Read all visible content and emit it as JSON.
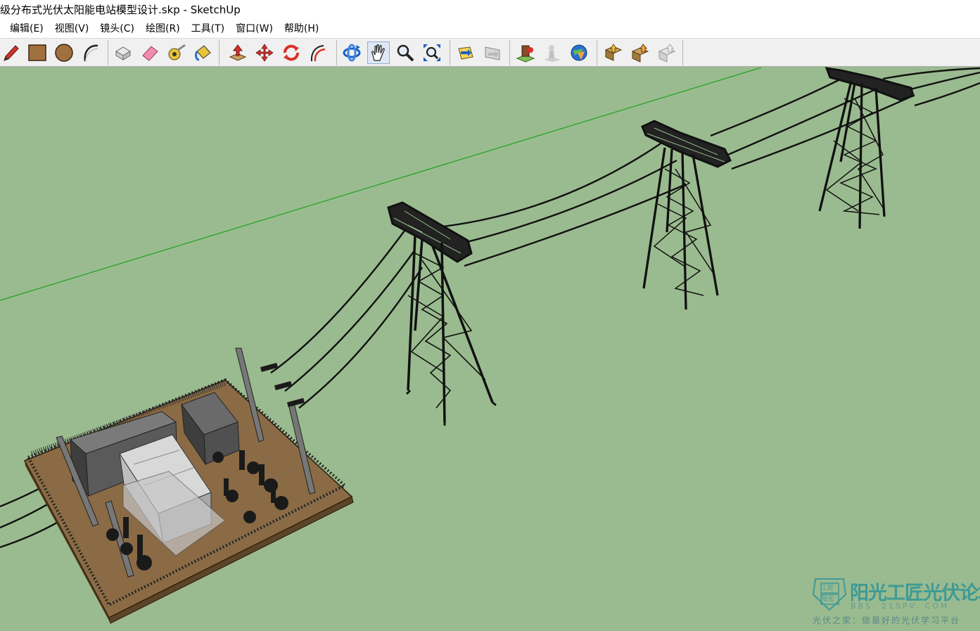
{
  "window": {
    "title": "级分布式光伏太阳能电站模型设计.skp - SketchUp"
  },
  "menu": {
    "items": [
      "编辑(E)",
      "视图(V)",
      "镜头(C)",
      "绘图(R)",
      "工具(T)",
      "窗口(W)",
      "帮助(H)"
    ]
  },
  "toolbar": {
    "tools": [
      {
        "name": "pencil-icon"
      },
      {
        "name": "rectangle-icon"
      },
      {
        "name": "circle-icon"
      },
      {
        "name": "arc-icon"
      },
      {
        "name": "make-component-icon"
      },
      {
        "name": "eraser-icon"
      },
      {
        "name": "tape-measure-icon"
      },
      {
        "name": "paint-bucket-icon"
      },
      {
        "name": "push-pull-icon"
      },
      {
        "name": "move-icon"
      },
      {
        "name": "rotate-icon"
      },
      {
        "name": "offset-icon"
      },
      {
        "name": "orbit-icon"
      },
      {
        "name": "pan-icon"
      },
      {
        "name": "zoom-icon"
      },
      {
        "name": "zoom-extents-icon"
      },
      {
        "name": "previous-view-icon"
      },
      {
        "name": "next-view-icon"
      },
      {
        "name": "add-location-icon"
      },
      {
        "name": "toggle-terrain-icon"
      },
      {
        "name": "google-earth-icon"
      },
      {
        "name": "get-models-icon"
      },
      {
        "name": "share-model-icon"
      },
      {
        "name": "share-component-icon"
      }
    ],
    "active_tool": "pan-icon"
  },
  "viewport": {
    "background_color": "#9abb8f",
    "axis_color": "#1fa21f"
  },
  "watermark": {
    "logo_text_top": "工匠",
    "logo_text_bottom": "阳光",
    "title": "阳光工匠光伏论坛",
    "url": "BBS. 21SPV. COM",
    "slogan": "光伏之家：做最好的光伏学习平台"
  }
}
